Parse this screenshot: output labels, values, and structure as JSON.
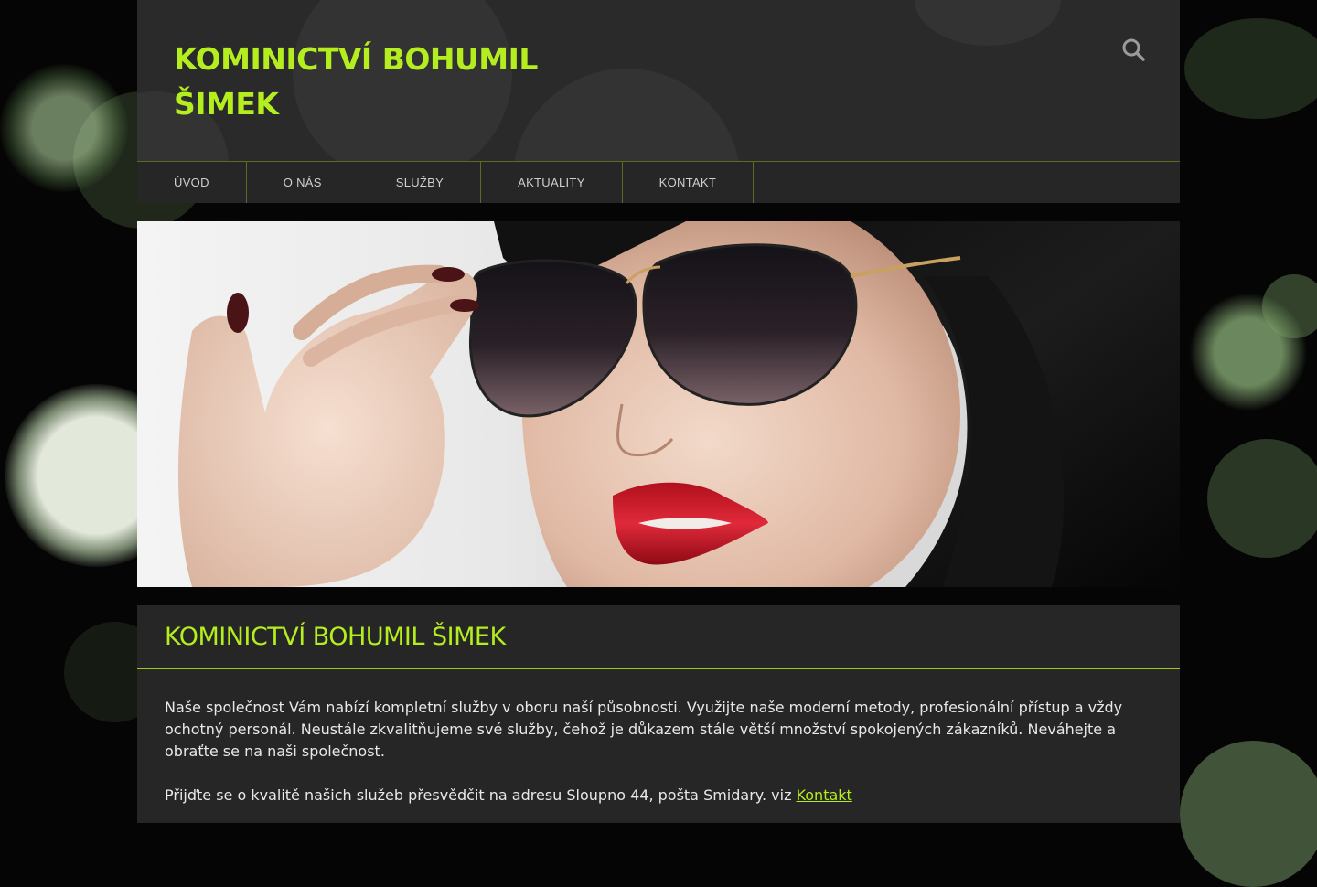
{
  "header": {
    "title": "KOMINICTVÍ BOHUMIL ŠIMEK",
    "search_icon": "search-icon"
  },
  "nav": {
    "items": [
      {
        "label": "ÚVOD"
      },
      {
        "label": "O NÁS"
      },
      {
        "label": "SLUŽBY"
      },
      {
        "label": "AKTUALITY"
      },
      {
        "label": "KONTAKT"
      }
    ]
  },
  "hero": {
    "image": "woman-sunglasses-photo"
  },
  "content": {
    "title": "KOMINICTVÍ BOHUMIL ŠIMEK",
    "paragraph1": "Naše společnost Vám nabízí kompletní služby v oboru naší působnosti. Využijte naše moderní metody, profesionální přístup a vždy ochotný personál. Neustále zkvalitňujeme své služby, čehož je důkazem stále větší množství spokojených zákazníků. Neváhejte a obraťte se na naši společnost.",
    "paragraph2_text": "Přijďte se o kvalitě našich služeb přesvědčit na adresu Sloupno 44, pošta Smidary. viz",
    "paragraph2_link": "Kontakt"
  },
  "colors": {
    "accent": "#b4ee1e",
    "panel": "#262626",
    "background": "#050505"
  }
}
